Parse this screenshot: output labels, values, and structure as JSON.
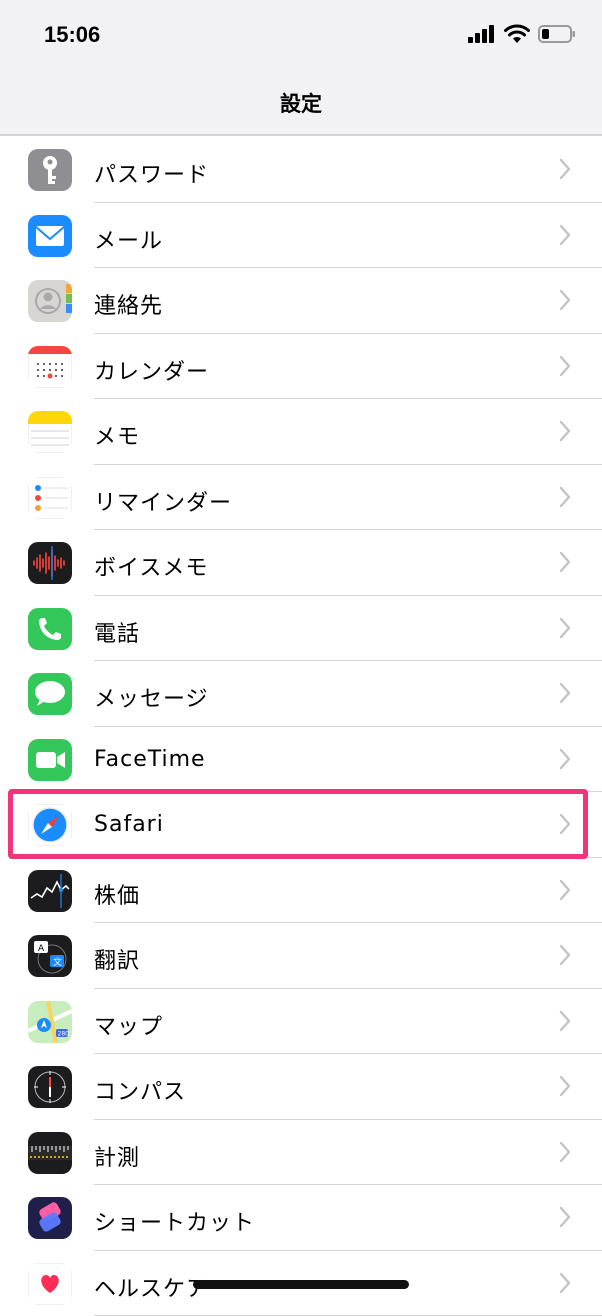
{
  "status": {
    "time": "15:06"
  },
  "nav": {
    "title": "設定"
  },
  "items": [
    {
      "label": "パスワード",
      "icon": "key-icon",
      "color": "#8e8e93"
    },
    {
      "label": "メール",
      "icon": "mail-icon",
      "color": "#1a8cff"
    },
    {
      "label": "連絡先",
      "icon": "contacts-icon",
      "color": "#c8c8c8"
    },
    {
      "label": "カレンダー",
      "icon": "calendar-icon",
      "color": "#ffffff"
    },
    {
      "label": "メモ",
      "icon": "notes-icon",
      "color": "#ffd60a"
    },
    {
      "label": "リマインダー",
      "icon": "reminders-icon",
      "color": "#ffffff"
    },
    {
      "label": "ボイスメモ",
      "icon": "voice-memo-icon",
      "color": "#1c1c1e"
    },
    {
      "label": "電話",
      "icon": "phone-icon",
      "color": "#34c759"
    },
    {
      "label": "メッセージ",
      "icon": "messages-icon",
      "color": "#34c759"
    },
    {
      "label": "FaceTime",
      "icon": "facetime-icon",
      "color": "#34c759"
    },
    {
      "label": "Safari",
      "icon": "safari-icon",
      "color": "#ffffff"
    },
    {
      "label": "株価",
      "icon": "stocks-icon",
      "color": "#1c1c1e"
    },
    {
      "label": "翻訳",
      "icon": "translate-icon",
      "color": "#1c1c1e"
    },
    {
      "label": "マップ",
      "icon": "maps-icon",
      "color": "#8bd17c"
    },
    {
      "label": "コンパス",
      "icon": "compass-icon",
      "color": "#1c1c1e"
    },
    {
      "label": "計測",
      "icon": "measure-icon",
      "color": "#1c1c1e"
    },
    {
      "label": "ショートカット",
      "icon": "shortcuts-icon",
      "color": "#3a3ac8"
    },
    {
      "label": "ヘルスケア",
      "icon": "health-icon",
      "color": "#ffffff"
    }
  ],
  "highlight": {
    "item": "Safari",
    "color": "#f2347a"
  }
}
